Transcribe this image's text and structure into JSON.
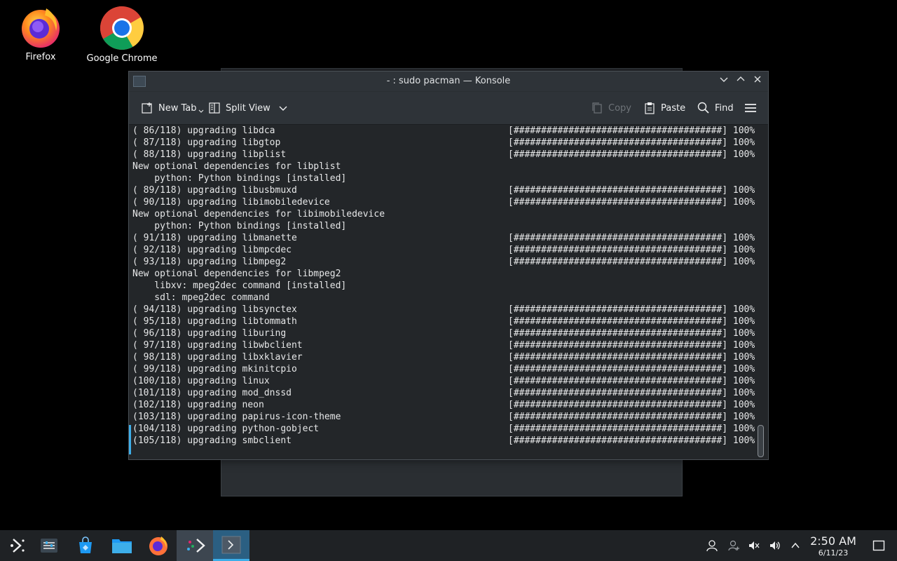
{
  "desktop": {
    "icons": [
      {
        "label": "Firefox"
      },
      {
        "label": "Google Chrome"
      }
    ]
  },
  "window": {
    "title": "- : sudo pacman — Konsole",
    "toolbar": {
      "new_tab": "New Tab",
      "split_view": "Split View",
      "copy": "Copy",
      "paste": "Paste",
      "find": "Find"
    }
  },
  "terminal": {
    "lines": [
      {
        "left": "( 86/118) upgrading libdca",
        "right": "[######################################] 100%"
      },
      {
        "left": "( 87/118) upgrading libgtop",
        "right": "[######################################] 100%"
      },
      {
        "left": "( 88/118) upgrading libplist",
        "right": "[######################################] 100%"
      },
      {
        "left": "New optional dependencies for libplist",
        "right": ""
      },
      {
        "left": "    python: Python bindings [installed]",
        "right": ""
      },
      {
        "left": "( 89/118) upgrading libusbmuxd",
        "right": "[######################################] 100%"
      },
      {
        "left": "( 90/118) upgrading libimobiledevice",
        "right": "[######################################] 100%"
      },
      {
        "left": "New optional dependencies for libimobiledevice",
        "right": ""
      },
      {
        "left": "    python: Python bindings [installed]",
        "right": ""
      },
      {
        "left": "( 91/118) upgrading libmanette",
        "right": "[######################################] 100%"
      },
      {
        "left": "( 92/118) upgrading libmpcdec",
        "right": "[######################################] 100%"
      },
      {
        "left": "( 93/118) upgrading libmpeg2",
        "right": "[######################################] 100%"
      },
      {
        "left": "New optional dependencies for libmpeg2",
        "right": ""
      },
      {
        "left": "    libxv: mpeg2dec command [installed]",
        "right": ""
      },
      {
        "left": "    sdl: mpeg2dec command",
        "right": ""
      },
      {
        "left": "( 94/118) upgrading libsynctex",
        "right": "[######################################] 100%"
      },
      {
        "left": "( 95/118) upgrading libtommath",
        "right": "[######################################] 100%"
      },
      {
        "left": "( 96/118) upgrading liburing",
        "right": "[######################################] 100%"
      },
      {
        "left": "( 97/118) upgrading libwbclient",
        "right": "[######################################] 100%"
      },
      {
        "left": "( 98/118) upgrading libxklavier",
        "right": "[######################################] 100%"
      },
      {
        "left": "( 99/118) upgrading mkinitcpio",
        "right": "[######################################] 100%"
      },
      {
        "left": "(100/118) upgrading linux",
        "right": "[######################################] 100%"
      },
      {
        "left": "(101/118) upgrading mod_dnssd",
        "right": "[######################################] 100%"
      },
      {
        "left": "(102/118) upgrading neon",
        "right": "[######################################] 100%"
      },
      {
        "left": "(103/118) upgrading papirus-icon-theme",
        "right": "[######################################] 100%"
      },
      {
        "left": "(104/118) upgrading python-gobject",
        "right": "[######################################] 100%"
      },
      {
        "left": "(105/118) upgrading smbclient",
        "right": "[######################################] 100%"
      }
    ]
  },
  "taskbar": {
    "clock": {
      "time": "2:50 AM",
      "date": "6/11/23"
    }
  },
  "colors": {
    "accent": "#3daee9",
    "window_bg": "#232629",
    "titlebar_bg": "#2e3338",
    "taskbar_bg": "#1f2225"
  }
}
